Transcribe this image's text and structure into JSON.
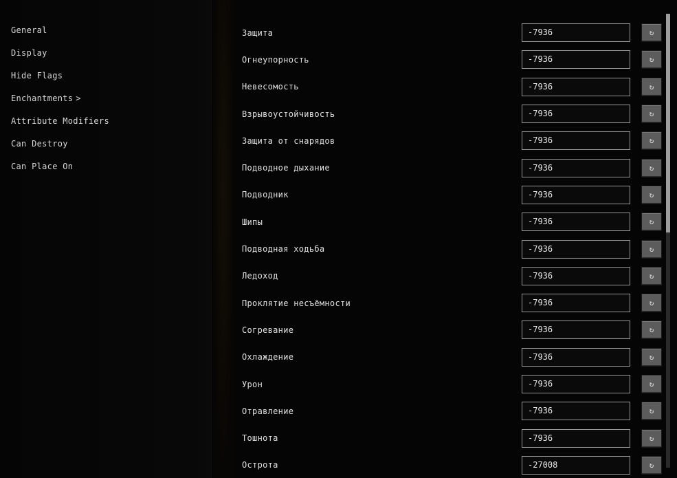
{
  "sidebar": {
    "items": [
      {
        "label": "General"
      },
      {
        "label": "Display"
      },
      {
        "label": "Hide Flags"
      },
      {
        "label": "Enchantments",
        "expandable": true
      },
      {
        "label": "Attribute Modifiers"
      },
      {
        "label": "Can Destroy"
      },
      {
        "label": "Can Place On"
      }
    ],
    "chevron": ">"
  },
  "enchantments": [
    {
      "label": "Защита",
      "value": "-7936"
    },
    {
      "label": "Огнеупорность",
      "value": "-7936"
    },
    {
      "label": "Невесомость",
      "value": "-7936"
    },
    {
      "label": "Взрывоустойчивость",
      "value": "-7936"
    },
    {
      "label": "Защита от снарядов",
      "value": "-7936"
    },
    {
      "label": "Подводное дыхание",
      "value": "-7936"
    },
    {
      "label": "Подводник",
      "value": "-7936"
    },
    {
      "label": "Шипы",
      "value": "-7936"
    },
    {
      "label": "Подводная ходьба",
      "value": "-7936"
    },
    {
      "label": "Ледоход",
      "value": "-7936"
    },
    {
      "label": "Проклятие несъёмности",
      "value": "-7936"
    },
    {
      "label": "Согревание",
      "value": "-7936"
    },
    {
      "label": "Охлаждение",
      "value": "-7936"
    },
    {
      "label": "Урон",
      "value": "-7936"
    },
    {
      "label": "Отравление",
      "value": "-7936"
    },
    {
      "label": "Тошнота",
      "value": "-7936"
    },
    {
      "label": "Острота",
      "value": "-27008"
    }
  ],
  "reset_icon": "↻",
  "scrollbar": {
    "thumb_top": 0,
    "thumb_height": 318
  }
}
